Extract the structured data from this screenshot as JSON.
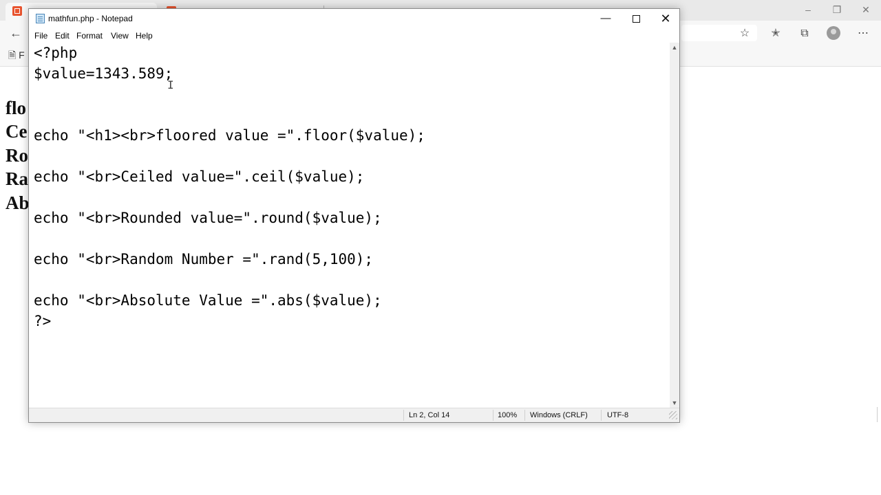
{
  "browser": {
    "favorites_item": "F",
    "page_lines": [
      "flo",
      "Ce",
      "Ro",
      "Ra",
      "Ab"
    ]
  },
  "notepad": {
    "title": "mathfun.php - Notepad",
    "menu": [
      "File",
      "Edit",
      "Format",
      "View",
      "Help"
    ],
    "code_lines": [
      "<?php",
      "$value=1343.589;",
      "",
      "",
      "echo \"<h1><br>floored value =\".floor($value);",
      "",
      "echo \"<br>Ceiled value=\".ceil($value);",
      "",
      "echo \"<br>Rounded value=\".round($value);",
      "",
      "echo \"<br>Random Number =\".rand(5,100);",
      "",
      "echo \"<br>Absolute Value =\".abs($value);",
      "?>"
    ],
    "status": {
      "position": "Ln 2, Col 14",
      "zoom": "100%",
      "line_ending": "Windows (CRLF)",
      "encoding": "UTF-8"
    }
  }
}
